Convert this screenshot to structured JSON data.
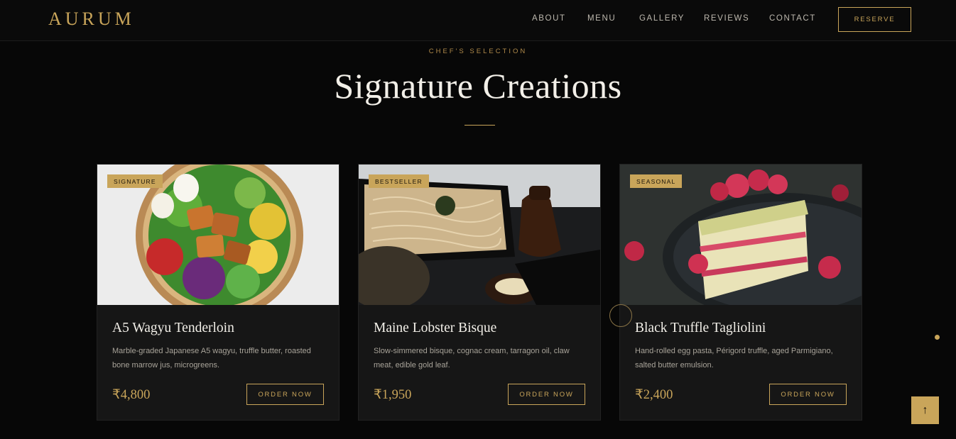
{
  "brand": {
    "logo": "AURUM",
    "accent": "#c9a55a"
  },
  "nav": {
    "links": [
      "ABOUT",
      "MENU",
      "GALLERY",
      "REVIEWS",
      "CONTACT"
    ],
    "reserve_label": "RESERVE"
  },
  "section": {
    "eyebrow": "CHEF'S SELECTION",
    "title": "Signature Creations"
  },
  "cards": [
    {
      "badge": "SIGNATURE",
      "title": "A5 Wagyu Tenderloin",
      "description": "Marble-graded Japanese A5 wagyu, truffle butter, roasted bone marrow jus, microgreens.",
      "price": "₹4,800",
      "button": "ORDER NOW",
      "image": "poke-bowl"
    },
    {
      "badge": "BESTSELLER",
      "title": "Maine Lobster Bisque",
      "description": "Slow-simmered bisque, cognac cream, tarragon oil, claw meat, edible gold leaf.",
      "price": "₹1,950",
      "button": "ORDER NOW",
      "image": "soba-noodles"
    },
    {
      "badge": "SEASONAL",
      "title": "Black Truffle Tagliolini",
      "description": "Hand-rolled egg pasta, Périgord truffle, aged Parmigiano, salted butter emulsion.",
      "price": "₹2,400",
      "button": "ORDER NOW",
      "image": "raspberry-cake"
    }
  ],
  "back_to_top": "↑"
}
